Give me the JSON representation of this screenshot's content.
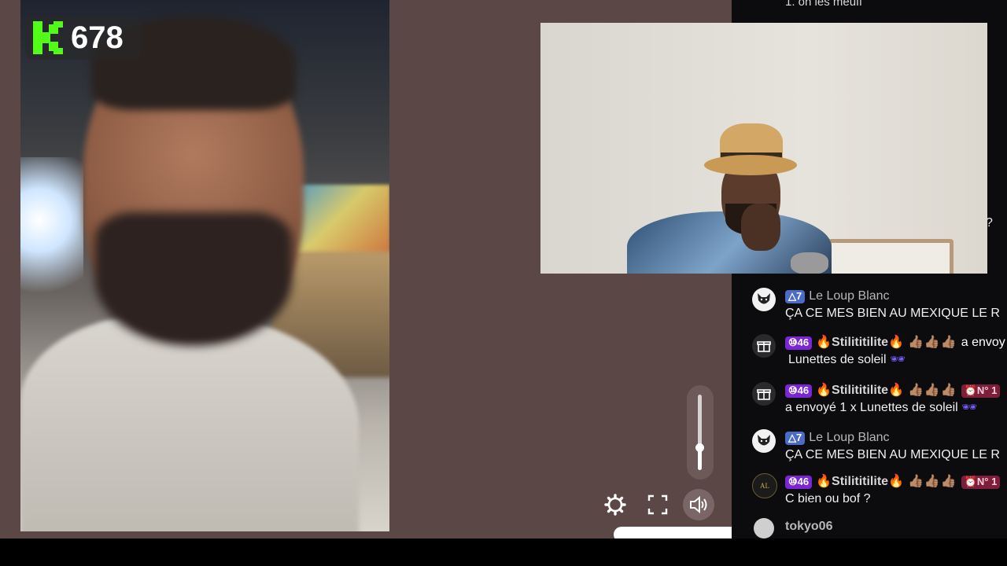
{
  "viewer_count": "678",
  "chat": {
    "top_partial": "1. oñ les meufl",
    "partial_question": "?",
    "messages": [
      {
        "avatar": "wolf-avatar",
        "level": "△7",
        "user": "Le Loup Blanc",
        "text": "ÇA CE MES BIEN AU MEXIQUE LE R"
      },
      {
        "avatar": "gift-icon",
        "sub": "⑩46",
        "user": "🔥Stilititilite🔥",
        "hands": "👍🏽👍🏽👍🏽",
        "trail": "a envoy",
        "text": "Lunettes de soleil",
        "emoji": "🕶"
      },
      {
        "avatar": "gift-icon",
        "sub": "⑩46",
        "user": "🔥Stilititilite🔥",
        "hands": "👍🏽👍🏽👍🏽",
        "rank": "⏰N° 1",
        "text": "a envoyé 1 x Lunettes de soleil",
        "emoji": "🕶"
      },
      {
        "avatar": "wolf-avatar",
        "level": "△7",
        "user": "Le Loup Blanc",
        "text": "ÇA CE MES BIEN AU MEXIQUE LE R"
      },
      {
        "avatar": "legend-avatar",
        "sub": "⑩46",
        "user": "🔥Stilititilite🔥",
        "hands": "👍🏽👍🏽👍🏽",
        "rank": "⏰N° 1",
        "text": "C bien ou bof ?"
      },
      {
        "avatar": "plain-avatar",
        "user": "tokyo06"
      }
    ]
  },
  "controls": {
    "volume_level": 0.3,
    "settings": "gear-icon",
    "fullscreen": "fullscreen-icon",
    "volume": "speaker-icon"
  },
  "colors": {
    "brand": "#53fc18",
    "stage_bg": "#5c4747",
    "chat_bg": "#0c0c0e"
  }
}
